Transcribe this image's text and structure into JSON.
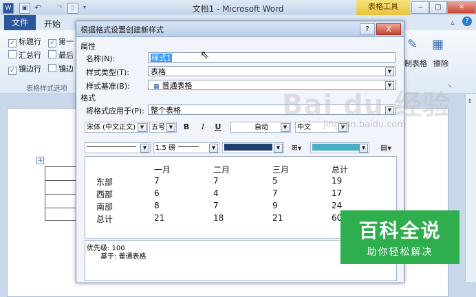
{
  "word": {
    "title": "文档1 - Microsoft Word",
    "contextual_tab": "表格工具",
    "tab_file": "文件",
    "tab_home": "开始",
    "ribbon_checks": [
      {
        "label": "标题行",
        "checked": true
      },
      {
        "label": "第一",
        "checked": true
      },
      {
        "label": "汇总行",
        "checked": false
      },
      {
        "label": "最后",
        "checked": false
      },
      {
        "label": "镶边行",
        "checked": true
      },
      {
        "label": "镶边",
        "checked": false
      }
    ],
    "group_label": "表格样式选项",
    "ribbon_right": {
      "draw_table": "制表格",
      "eraser": "擦除"
    },
    "help_glyph": "?"
  },
  "dialog": {
    "title": "根据格式设置创建新样式",
    "help": "?",
    "close": "X",
    "section_properties": "属性",
    "name_label": "名称(N):",
    "name_value": "样式1",
    "type_label": "样式类型(T):",
    "type_value": "表格",
    "based_label": "样式基准(B):",
    "based_value": "普通表格",
    "section_format": "格式",
    "apply_label": "将格式应用于(P):",
    "apply_value": "整个表格",
    "toolbar1": {
      "font": "宋体 (中文正文)",
      "size": "五号",
      "bold": "B",
      "italic": "I",
      "underline": "U",
      "color": "自动",
      "script": "中文"
    },
    "toolbar2": {
      "border_weight": "1.5 磅",
      "border_color": "#1f3f73",
      "shading_color": "#4bacc6"
    },
    "preview": {
      "headers": [
        "一月",
        "二月",
        "三月",
        "总计"
      ],
      "rows": [
        {
          "label": "东部",
          "values": [
            "7",
            "7",
            "5",
            "19"
          ]
        },
        {
          "label": "西部",
          "values": [
            "6",
            "4",
            "7",
            "17"
          ]
        },
        {
          "label": "南部",
          "values": [
            "8",
            "7",
            "9",
            "24"
          ]
        },
        {
          "label": "总计",
          "values": [
            "21",
            "18",
            "21",
            "60"
          ]
        }
      ]
    },
    "description": {
      "line1": "优先级: 100",
      "line2": "基于: 普通表格"
    }
  },
  "watermark": {
    "baidu": "Bai du 经验",
    "url": "jingyan.baidu.com",
    "brand": "百科全说",
    "slogan": "助你轻松解决"
  }
}
